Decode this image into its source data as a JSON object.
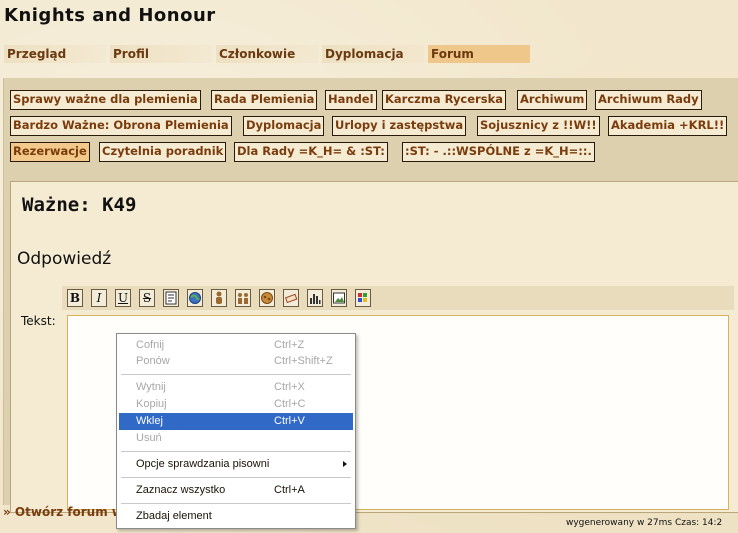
{
  "app": {
    "title": "Knights and Honour"
  },
  "nav": {
    "tabs": [
      "Przegląd",
      "Profil",
      "Członkowie",
      "Dyplomacja",
      "Forum"
    ],
    "active": "Forum"
  },
  "categories": [
    "Sprawy ważne dla plemienia",
    "Rada Plemienia",
    "Handel",
    "Karczma Rycerska",
    "Archiwum",
    "Archiwum Rady",
    "Bardzo Ważne: Obrona Plemienia",
    "Dyplomacja",
    "Urlopy i zastępstwa",
    "Sojusznicy z !!W!!",
    "Akademia +KRL!!",
    "Rezerwacje",
    "Czytelnia poradnik",
    "Dla Rady =K_H= & :ST:",
    ":ST: - .::WSPÓLNE z =K_H=::."
  ],
  "topic": {
    "title": "Ważne: K49"
  },
  "reply": {
    "heading": "Odpowiedź",
    "text_label": "Tekst:"
  },
  "toolbar": {
    "format_buttons": [
      "B",
      "I",
      "U",
      "S"
    ],
    "icon_buttons": [
      "quote-icon",
      "url-icon",
      "player-icon",
      "tribe-icon",
      "village-icon",
      "report-icon",
      "bar-chart-icon",
      "image-icon",
      "color-icon"
    ]
  },
  "context_menu": {
    "items": [
      {
        "label": "Cofnij",
        "shortcut": "Ctrl+Z"
      },
      {
        "label": "Ponów",
        "shortcut": "Ctrl+Shift+Z"
      },
      {
        "label": "Wytnij",
        "shortcut": "Ctrl+X"
      },
      {
        "label": "Kopiuj",
        "shortcut": "Ctrl+C"
      },
      {
        "label": "Wklej",
        "shortcut": "Ctrl+V"
      },
      {
        "label": "Usuń",
        "shortcut": ""
      },
      {
        "label": "Opcje sprawdzania pisowni",
        "shortcut": ""
      },
      {
        "label": "Zaznacz wszystko",
        "shortcut": "Ctrl+A"
      },
      {
        "label": "Zbadaj element",
        "shortcut": ""
      }
    ]
  },
  "footer": {
    "open_forum": "» Otwórz forum w",
    "generated": "wygenerowany w 27ms Czas: 14:2"
  },
  "colors": {
    "accent": "#f0c78a",
    "link": "#7a3c0c",
    "menu_highlight": "#3169c6"
  }
}
